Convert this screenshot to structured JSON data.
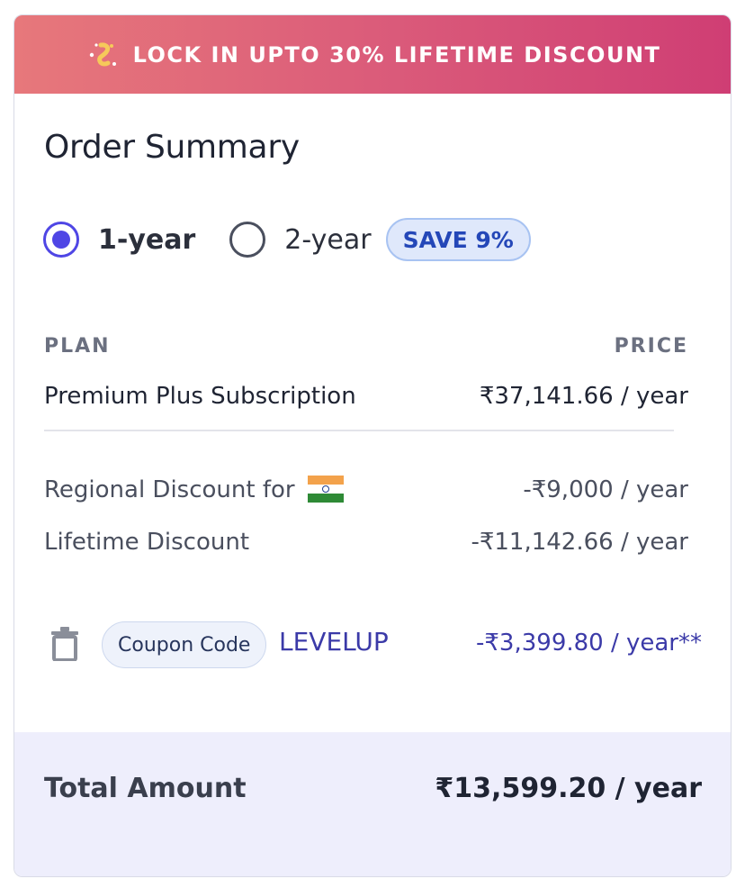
{
  "banner": {
    "icon": "sparkle-icon",
    "text": "LOCK IN UPTO 30% LIFETIME DISCOUNT"
  },
  "title": "Order Summary",
  "billing": {
    "options": [
      {
        "label": "1-year",
        "selected": true
      },
      {
        "label": "2-year",
        "selected": false
      }
    ],
    "badge": "SAVE 9%"
  },
  "table": {
    "plan_header": "PLAN",
    "price_header": "PRICE",
    "plan_name": "Premium Plus Subscription",
    "plan_price": "₹37,141.66 / year"
  },
  "discounts": [
    {
      "label": "Regional Discount for",
      "flag": "india-flag-icon",
      "amount": "-₹9,000 / year"
    },
    {
      "label": "Lifetime Discount",
      "amount": "-₹11,142.66 / year"
    }
  ],
  "coupon": {
    "pill_label": "Coupon Code",
    "code": "LEVELUP",
    "amount": "-₹3,399.80 / year**"
  },
  "total": {
    "label": "Total Amount",
    "amount": "₹13,599.20 / year"
  },
  "colors": {
    "banner_start": "#e7787b",
    "banner_end": "#cf3e74",
    "accent": "#4f46e5",
    "coupon_text": "#3b3aa8",
    "total_bg": "#eeeefc"
  }
}
